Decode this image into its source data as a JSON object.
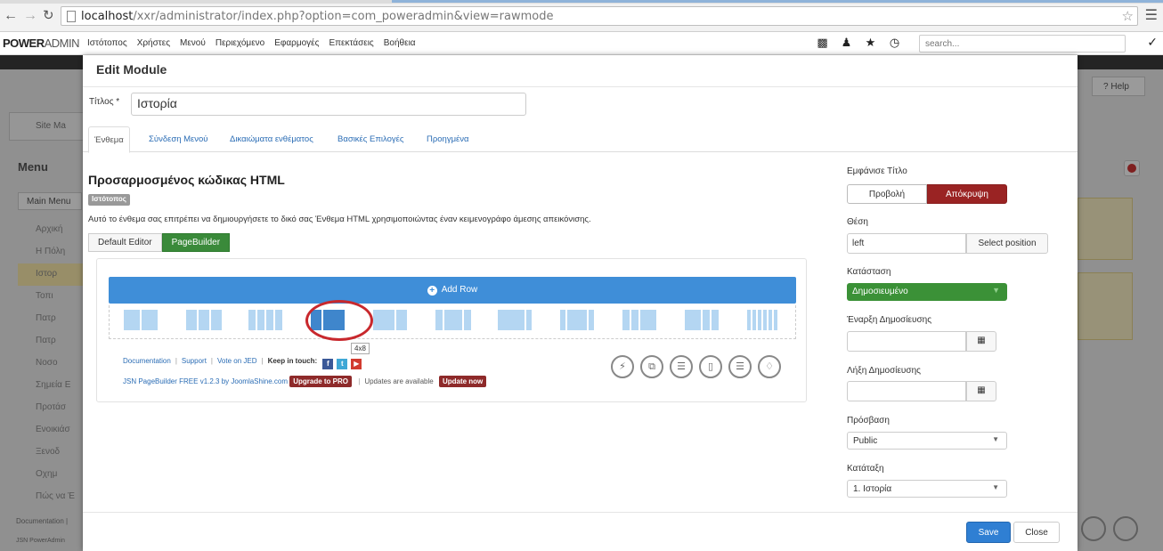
{
  "browser": {
    "url_host": "localhost",
    "url_path": "/xxr/administrator/index.php?option=com_poweradmin&view=rawmode",
    "back_icon": "arrow-left-icon",
    "forward_icon": "arrow-right-icon",
    "reload_icon": "reload-icon"
  },
  "admin_nav": {
    "brand_bold": "POWER",
    "brand_light": "ADMIN",
    "menu": [
      "Ιστότοπος",
      "Χρήστες",
      "Μενού",
      "Περιεχόμενο",
      "Εφαρμογές",
      "Επεκτάσεις",
      "Βοήθεια"
    ],
    "search_placeholder": "search..."
  },
  "background": {
    "site_menu": "Site Ma",
    "menu_title": "Menu",
    "main_menu": "Main Menu",
    "list": [
      "Αρχική",
      "Η Πόλη",
      "Ιστορ",
      "Τοπι",
      "Πατρ",
      "Πατρ",
      "Νοσο",
      "Σημεία Ε",
      "Προτάσ",
      "Ενοικιάσ",
      "Ξενοδ",
      "Οχημ",
      "Πώς να Έ"
    ],
    "help": "Help",
    "footer1": "Documentation |",
    "footer2": "JSN PowerAdmin"
  },
  "modal": {
    "title": "Edit Module",
    "title_label": "Τίτλος *",
    "title_value": "Ιστορία",
    "tabs": [
      "Ένθεμα",
      "Σύνδεση Μενού",
      "Δικαιώματα ενθέματος",
      "Βασικές Επιλογές",
      "Προηγμένα"
    ],
    "module_heading": "Προσαρμοσμένος κώδικας HTML",
    "site_badge": "Ιστότοπος",
    "description": "Αυτό το ένθεμα σας επιτρέπει να δημιουργήσετε το δικό σας Ένθεμα HTML χρησιμοποιώντας έναν κειμενογράφο άμεσης απεικόνισης.",
    "editor_default": "Default Editor",
    "editor_pagebuilder": "PageBuilder",
    "pagebuilder": {
      "add_row": "Add Row",
      "tooltip": "4x8",
      "links": {
        "documentation": "Documentation",
        "support": "Support",
        "vote": "Vote on JED",
        "keep_in_touch": "Keep in touch:"
      },
      "version_text": "JSN PageBuilder FREE v1.2.3 by JoomlaShine.com",
      "upgrade": "Upgrade to PRO",
      "updates_available": "Updates are available",
      "update_now": "Update now"
    },
    "right": {
      "show_title_label": "Εμφάνισε Τίτλο",
      "show": "Προβολή",
      "hide": "Απόκρυψη",
      "position_label": "Θέση",
      "position_value": "left",
      "select_position": "Select position",
      "status_label": "Κατάσταση",
      "status_value": "Δημοσιευμένο",
      "publish_start_label": "Έναρξη Δημοσίευσης",
      "publish_end_label": "Λήξη Δημοσίευσης",
      "access_label": "Πρόσβαση",
      "access_value": "Public",
      "ordering_label": "Κατάταξη",
      "ordering_value": "1. Ιστορία"
    },
    "save": "Save",
    "close": "Close"
  },
  "colors": {
    "primary_blue": "#3f8ed8",
    "success_green": "#3b9137",
    "danger_red": "#9a2323",
    "highlight_circle": "#c8282d"
  }
}
